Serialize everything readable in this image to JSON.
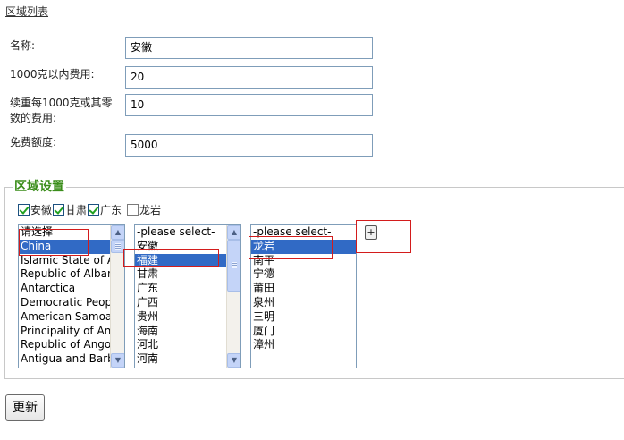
{
  "header": {
    "link_label": "区域列表"
  },
  "form": {
    "name": {
      "label": "名称:",
      "value": "安徽"
    },
    "first_weight_fee": {
      "label": "1000克以内费用:",
      "value": "20"
    },
    "additional_fee": {
      "label_line1": "续重每1000克或其零",
      "label_line2": "数的费用:",
      "value": "10"
    },
    "free_quota": {
      "label": "免费额度:",
      "value": "5000"
    }
  },
  "region": {
    "legend": "区域设置",
    "checkboxes": [
      {
        "label": "安徽",
        "checked": true
      },
      {
        "label": "甘肃",
        "checked": true
      },
      {
        "label": "广东",
        "checked": true
      },
      {
        "label": "龙岩",
        "checked": false
      }
    ],
    "country_list": {
      "options": [
        "请选择",
        "China",
        "Islamic State of A",
        "Republic of Alban",
        "Antarctica",
        "Democratic Peop",
        "American Samoa",
        "Principality of An",
        "Republic of Ango",
        "Antigua and Barb"
      ],
      "selected_index": 1
    },
    "province_list": {
      "options": [
        "-please select-",
        "安徽",
        "福建",
        "甘肃",
        "广东",
        "广西",
        "贵州",
        "海南",
        "河北",
        "河南"
      ],
      "selected_index": 2
    },
    "city_list": {
      "options": [
        "-please select-",
        "龙岩",
        "南平",
        "宁德",
        "莆田",
        "泉州",
        "三明",
        "厦门",
        "漳州"
      ],
      "selected_index": 1
    },
    "add_label": "+",
    "scroll_up_glyph": "▲",
    "scroll_down_glyph": "▼"
  },
  "footer": {
    "update_label": "更新"
  },
  "colors": {
    "selection": "#316ac5",
    "legend": "#3a8d1a",
    "highlight_border": "#d31c1c",
    "check": "#21a121"
  }
}
